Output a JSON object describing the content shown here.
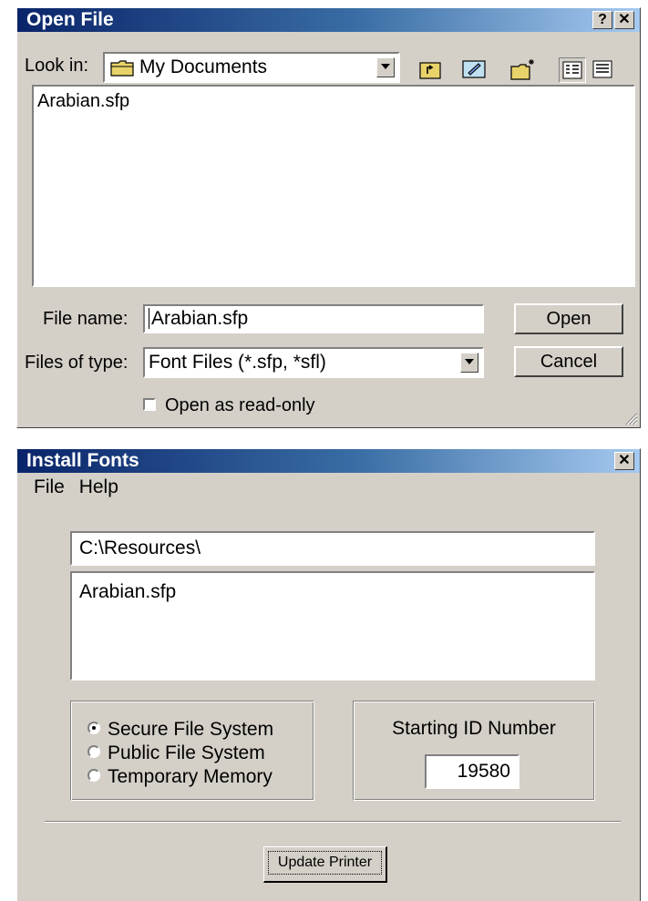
{
  "open_dialog": {
    "title": "Open File",
    "help_glyph": "?",
    "close_glyph": "✕",
    "look_in_label": "Look in:",
    "look_in_value": "My Documents",
    "toolbar_icons": [
      "folder-icon",
      "up-one-level-icon",
      "desktop-icon",
      "new-folder-icon",
      "list-view-icon",
      "details-view-icon"
    ],
    "files": [
      "Arabian.sfp"
    ],
    "file_name_label": "File name:",
    "file_name_value": "Arabian.sfp",
    "files_of_type_label": "Files of type:",
    "files_of_type_value": "Font Files (*.sfp, *sfl)",
    "open_label": "Open",
    "cancel_label": "Cancel",
    "read_only_label": "Open as read-only"
  },
  "install_dialog": {
    "title": "Install Fonts",
    "close_glyph": "✕",
    "menu": [
      "File",
      "Help"
    ],
    "path_value": "C:\\Resources\\",
    "selected_file": "Arabian.sfp",
    "destinations": [
      {
        "label": "Secure File System",
        "selected": true
      },
      {
        "label": "Public File System",
        "selected": false
      },
      {
        "label": "Temporary Memory",
        "selected": false
      }
    ],
    "starting_id_label": "Starting ID Number",
    "starting_id_value": "19580",
    "update_label": "Update Printer"
  }
}
